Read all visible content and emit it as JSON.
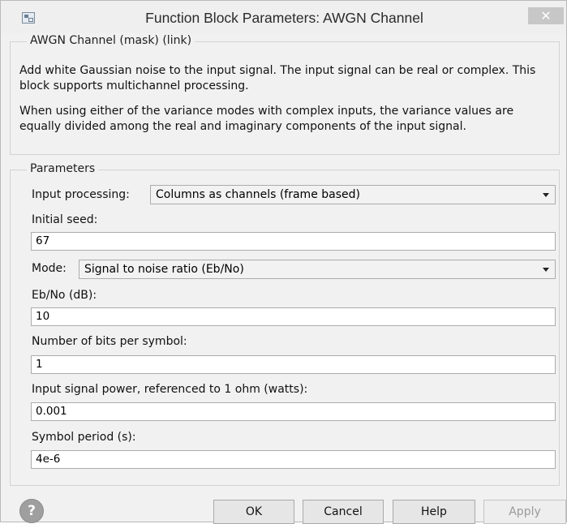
{
  "window": {
    "title": "Function Block Parameters: AWGN Channel",
    "close_glyph": "✕"
  },
  "block": {
    "group_title": "AWGN Channel (mask) (link)",
    "description_1": "Add white Gaussian noise to the input signal. The input signal can be real or complex. This block supports multichannel processing.",
    "description_2": "When using either of the variance modes with complex inputs, the variance values are equally divided among the real and imaginary components of the input signal."
  },
  "parameters": {
    "group_title": "Parameters",
    "input_processing": {
      "label": "Input processing:",
      "value": "Columns as channels (frame based)"
    },
    "initial_seed": {
      "label": "Initial seed:",
      "value": "67"
    },
    "mode": {
      "label": "Mode:",
      "value": "Signal to noise ratio  (Eb/No)"
    },
    "ebno": {
      "label": "Eb/No (dB):",
      "value": "10"
    },
    "bits_per_symbol": {
      "label": "Number of bits per symbol:",
      "value": "1"
    },
    "signal_power": {
      "label": "Input signal power, referenced to 1 ohm (watts):",
      "value": "0.001"
    },
    "symbol_period": {
      "label": "Symbol period (s):",
      "value": "4e-6"
    }
  },
  "buttons": {
    "ok": "OK",
    "cancel": "Cancel",
    "help": "Help",
    "apply": "Apply"
  },
  "icons": {
    "app": "block-parameters-icon",
    "help": "help-question-icon",
    "help_glyph": "?"
  }
}
